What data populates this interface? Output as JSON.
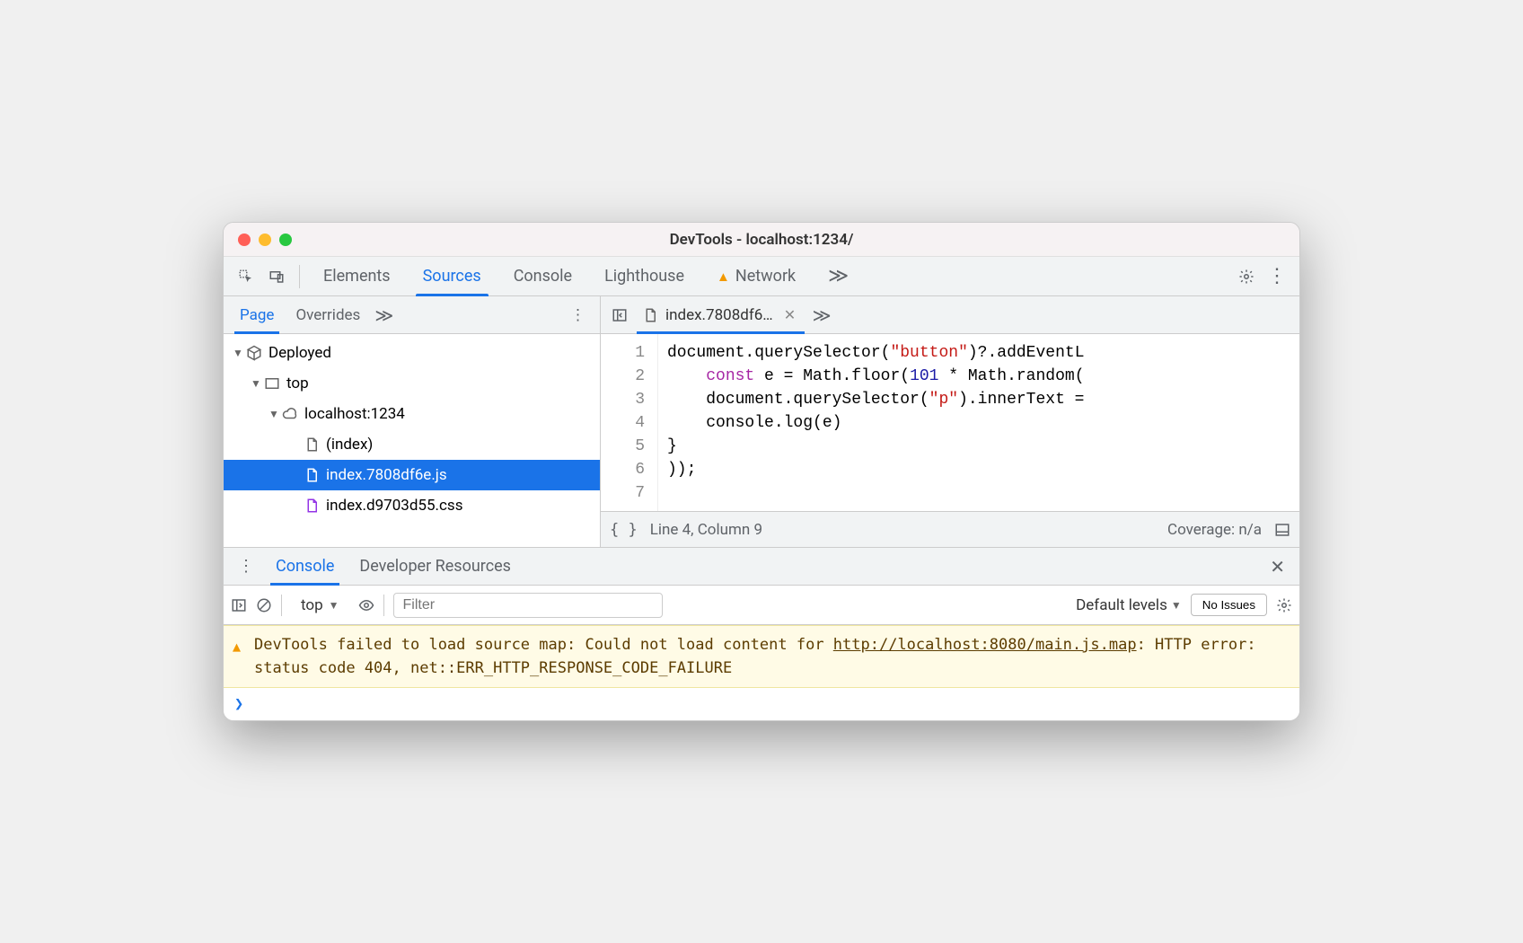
{
  "window": {
    "title": "DevTools - localhost:1234/"
  },
  "mainTabs": {
    "items": [
      "Elements",
      "Sources",
      "Console",
      "Lighthouse",
      "Network"
    ],
    "activeIndex": 1,
    "networkHasWarning": true
  },
  "sourcesLeft": {
    "tabs": [
      "Page",
      "Overrides"
    ],
    "activeIndex": 0
  },
  "tree": {
    "root": "Deployed",
    "top": "top",
    "domain": "localhost:1234",
    "files": [
      {
        "name": "(index)",
        "type": "html"
      },
      {
        "name": "index.7808df6e.js",
        "type": "js",
        "selected": true
      },
      {
        "name": "index.d9703d55.css",
        "type": "css"
      }
    ]
  },
  "editor": {
    "openTab": "index.7808df6…",
    "lines": [
      {
        "n": 1,
        "tokens": [
          {
            "t": "document.querySelector("
          },
          {
            "t": "\"button\"",
            "c": "k-str"
          },
          {
            "t": ")?.addEventL"
          }
        ]
      },
      {
        "n": 2,
        "tokens": [
          {
            "t": "    "
          },
          {
            "t": "const",
            "c": "k-kw"
          },
          {
            "t": " e = Math.floor("
          },
          {
            "t": "101",
            "c": "k-num"
          },
          {
            "t": " * Math.random("
          }
        ]
      },
      {
        "n": 3,
        "tokens": [
          {
            "t": "    document.querySelector("
          },
          {
            "t": "\"p\"",
            "c": "k-str"
          },
          {
            "t": ").innerText ="
          }
        ]
      },
      {
        "n": 4,
        "tokens": [
          {
            "t": "    console.log(e)"
          }
        ]
      },
      {
        "n": 5,
        "tokens": [
          {
            "t": "}"
          }
        ]
      },
      {
        "n": 6,
        "tokens": [
          {
            "t": "));"
          }
        ]
      },
      {
        "n": 7,
        "tokens": [
          {
            "t": ""
          }
        ]
      }
    ],
    "status": {
      "position": "Line 4, Column 9",
      "coverage": "Coverage: n/a"
    }
  },
  "drawer": {
    "tabs": [
      "Console",
      "Developer Resources"
    ],
    "activeIndex": 0
  },
  "console": {
    "context": "top",
    "filterPlaceholder": "Filter",
    "levels": "Default levels",
    "issuesLabel": "No Issues",
    "warning": {
      "prefix": "DevTools failed to load source map: Could not load content for ",
      "url": "http://localhost:8080/main.js.map",
      "suffix": ": HTTP error: status code 404, net::ERR_HTTP_RESPONSE_CODE_FAILURE"
    }
  }
}
